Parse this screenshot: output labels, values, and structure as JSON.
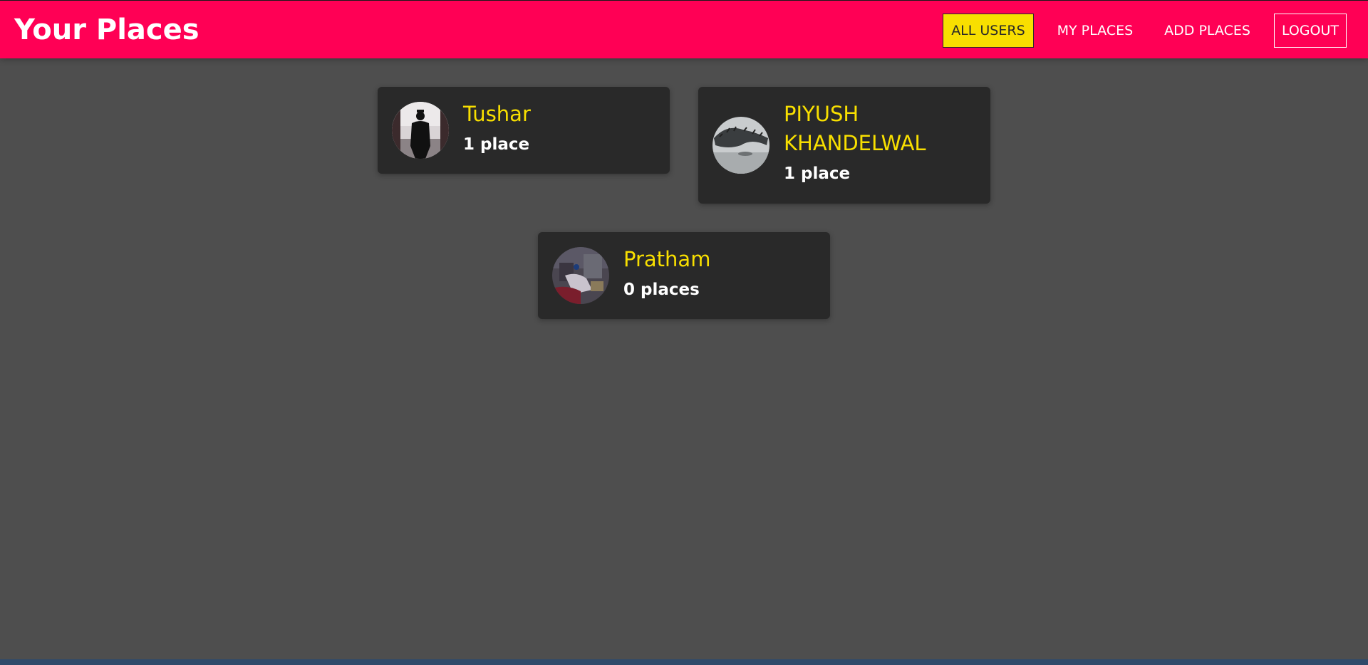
{
  "header": {
    "brand": "Your Places",
    "nav": [
      {
        "label": "ALL USERS"
      },
      {
        "label": "MY PLACES"
      },
      {
        "label": "ADD PLACES"
      },
      {
        "label": "LOGOUT"
      }
    ]
  },
  "users": [
    {
      "name": "Tushar",
      "places": "1 place"
    },
    {
      "name": "PIYUSH KHANDELWAL",
      "places": "1 place"
    },
    {
      "name": "Pratham",
      "places": "0 places"
    }
  ],
  "colors": {
    "header_bg": "#ff0055",
    "page_bg": "#4e4e4e",
    "card_bg": "#292929",
    "accent": "#f8df00"
  }
}
